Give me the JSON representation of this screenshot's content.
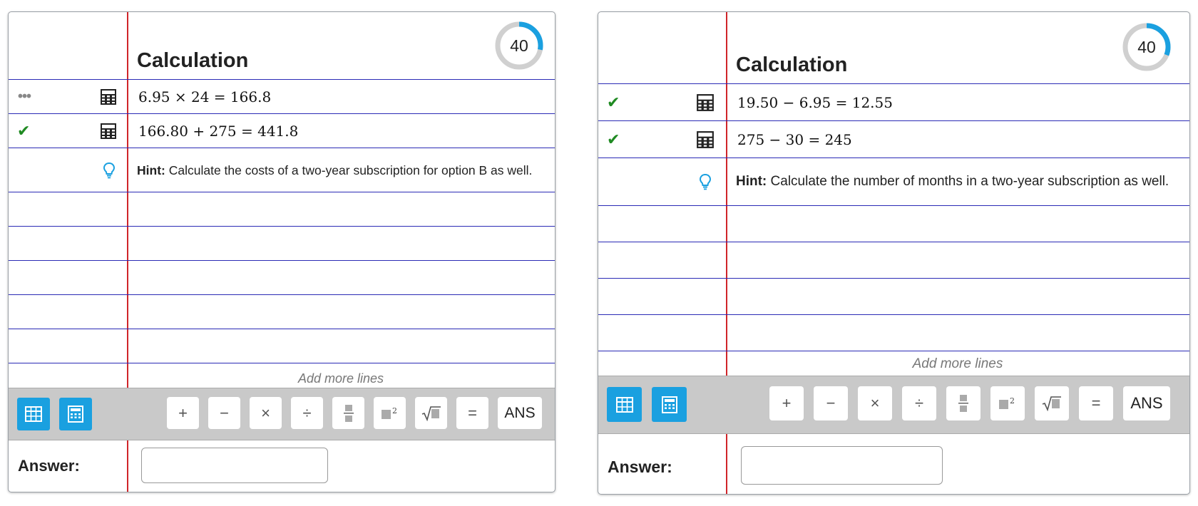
{
  "panels": [
    {
      "title": "Calculation",
      "timer": {
        "value": "40",
        "progress": 0.28
      },
      "rows": [
        {
          "status": "dots",
          "expression": "6.95 × 24 = 166.8"
        },
        {
          "status": "check",
          "expression": "166.80 + 275 = 441.8"
        }
      ],
      "hint": {
        "label": "Hint:",
        "text": " Calculate the costs of a two-year subscription for option B as well."
      },
      "add_more_lines": "Add more lines",
      "toolbar": {
        "buttons": [
          "+",
          "−",
          "×",
          "÷",
          "fraction",
          "square",
          "sqrt",
          "=",
          "ANS"
        ]
      },
      "answer": {
        "label": "Answer:",
        "value": ""
      }
    },
    {
      "title": "Calculation",
      "timer": {
        "value": "40",
        "progress": 0.31
      },
      "rows": [
        {
          "status": "check",
          "expression": "19.50 − 6.95 = 12.55"
        },
        {
          "status": "check",
          "expression": "275 − 30 = 245"
        }
      ],
      "hint": {
        "label": "Hint:",
        "text": " Calculate the number of months in a two-year subscription as well."
      },
      "add_more_lines": "Add more lines",
      "toolbar": {
        "buttons": [
          "+",
          "−",
          "×",
          "÷",
          "fraction",
          "square",
          "sqrt",
          "=",
          "ANS"
        ]
      },
      "answer": {
        "label": "Answer:",
        "value": ""
      }
    }
  ],
  "colors": {
    "accent_blue": "#1aa0e0",
    "rule_blue": "#2a2ab5",
    "margin_red": "#d0252a",
    "check_green": "#1f8a22",
    "toolbar_gray": "#c9c9c9"
  }
}
